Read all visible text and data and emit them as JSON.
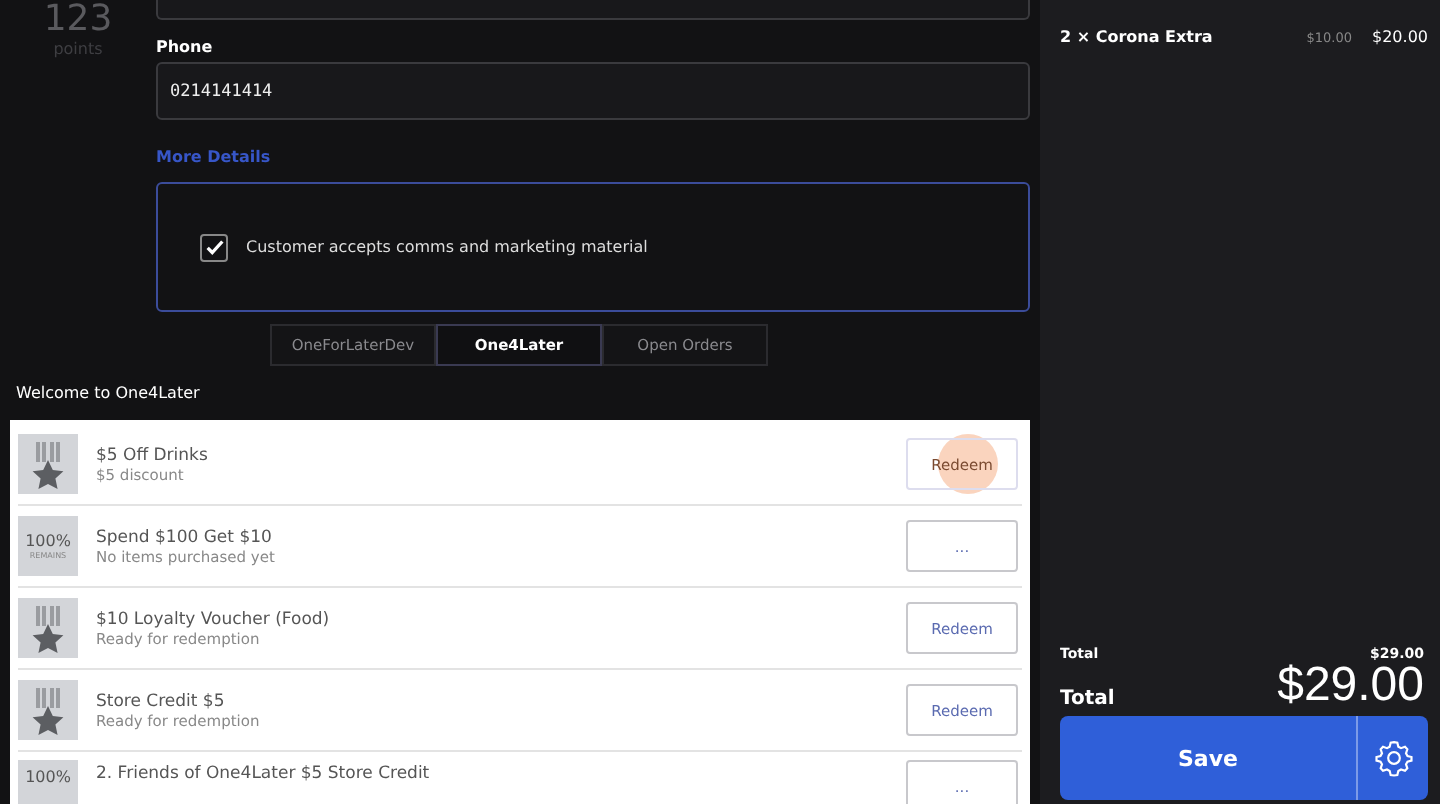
{
  "customer": {
    "points": "123",
    "points_label": "points",
    "phone_label": "Phone",
    "phone_value": "0214141414",
    "more_details": "More Details",
    "marketing": {
      "label": "Customer accepts comms and marketing material",
      "checked": true
    }
  },
  "tabs": [
    {
      "label": "OneForLaterDev",
      "selected": false
    },
    {
      "label": "One4Later",
      "selected": true
    },
    {
      "label": "Open Orders",
      "selected": false
    }
  ],
  "welcome": "Welcome to One4Later",
  "rewards": [
    {
      "kind": "medal",
      "title": "$5 Off Drinks",
      "subtitle": "$5 discount",
      "button": "Redeem",
      "pressed": true
    },
    {
      "kind": "progress",
      "percent": "100%",
      "remains": "REMAINS",
      "title": "Spend $100 Get $10",
      "subtitle": "No items purchased yet",
      "button": "...",
      "pressed": false
    },
    {
      "kind": "medal",
      "title": "$10 Loyalty Voucher (Food)",
      "subtitle": "Ready for redemption",
      "button": "Redeem",
      "pressed": false
    },
    {
      "kind": "medal",
      "title": "Store Credit $5",
      "subtitle": "Ready for redemption",
      "button": "Redeem",
      "pressed": false
    },
    {
      "kind": "progress",
      "percent": "100%",
      "title": "2. Friends of One4Later $5 Store Credit",
      "button": "...",
      "pressed": false
    }
  ],
  "order": {
    "items": [
      {
        "name": "2 × Corona Extra",
        "unit": "$10.00",
        "amount": "$20.00"
      }
    ],
    "subtotal_label": "Total",
    "subtotal": "$29.00",
    "total_label": "Total",
    "total": "$29.00",
    "save": "Save"
  }
}
